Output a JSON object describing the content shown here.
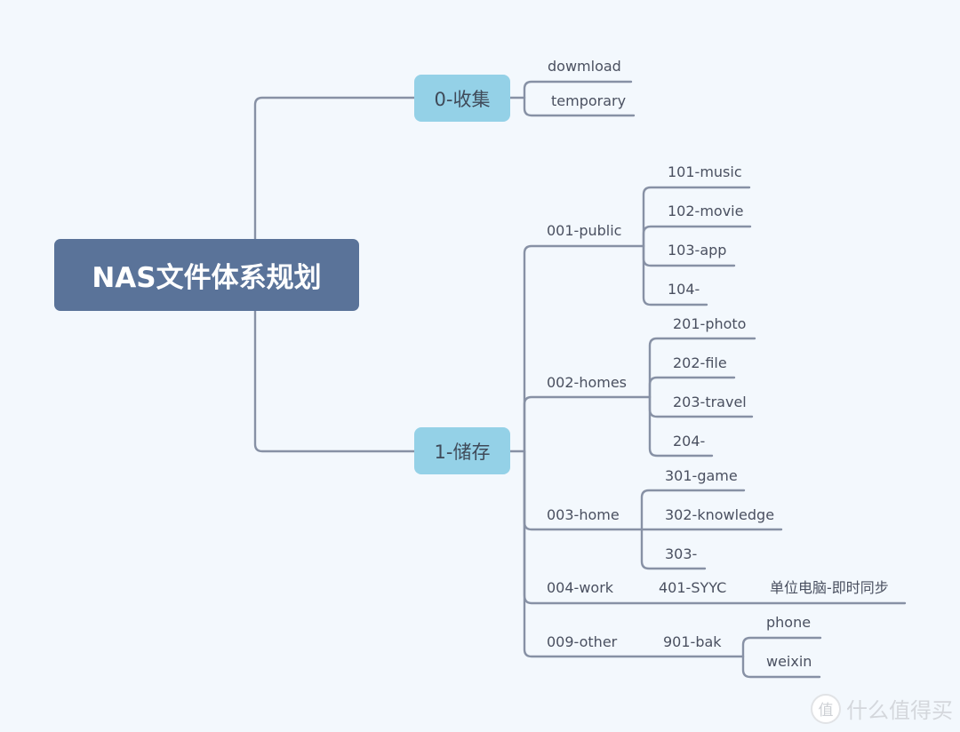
{
  "root": {
    "label": "NAS文件体系规划"
  },
  "branches": [
    {
      "label": "0-收集",
      "children": [
        {
          "label": "dowmload"
        },
        {
          "label": "temporary"
        }
      ]
    },
    {
      "label": "1-储存",
      "children": [
        {
          "label": "001-public",
          "children": [
            {
              "label": "101-music"
            },
            {
              "label": "102-movie"
            },
            {
              "label": "103-app"
            },
            {
              "label": "104-"
            }
          ]
        },
        {
          "label": "002-homes",
          "children": [
            {
              "label": "201-photo"
            },
            {
              "label": "202-file"
            },
            {
              "label": "203-travel"
            },
            {
              "label": "204-"
            }
          ]
        },
        {
          "label": "003-home",
          "children": [
            {
              "label": "301-game"
            },
            {
              "label": "302-knowledge"
            },
            {
              "label": "303-"
            }
          ]
        },
        {
          "label": "004-work",
          "children": [
            {
              "label": "401-SYYC",
              "children": [
                {
                  "label": "单位电脑-即时同步"
                }
              ]
            }
          ]
        },
        {
          "label": "009-other",
          "children": [
            {
              "label": "901-bak",
              "children": [
                {
                  "label": "phone"
                },
                {
                  "label": "weixin"
                }
              ]
            }
          ]
        }
      ]
    }
  ],
  "watermark": {
    "badge": "值",
    "text": "什么值得买"
  },
  "colors": {
    "background": "#f3f8fd",
    "root_fill": "#5a7399",
    "main_fill": "#94d1e7",
    "line": "#8791a5",
    "text": "#4a5060"
  }
}
